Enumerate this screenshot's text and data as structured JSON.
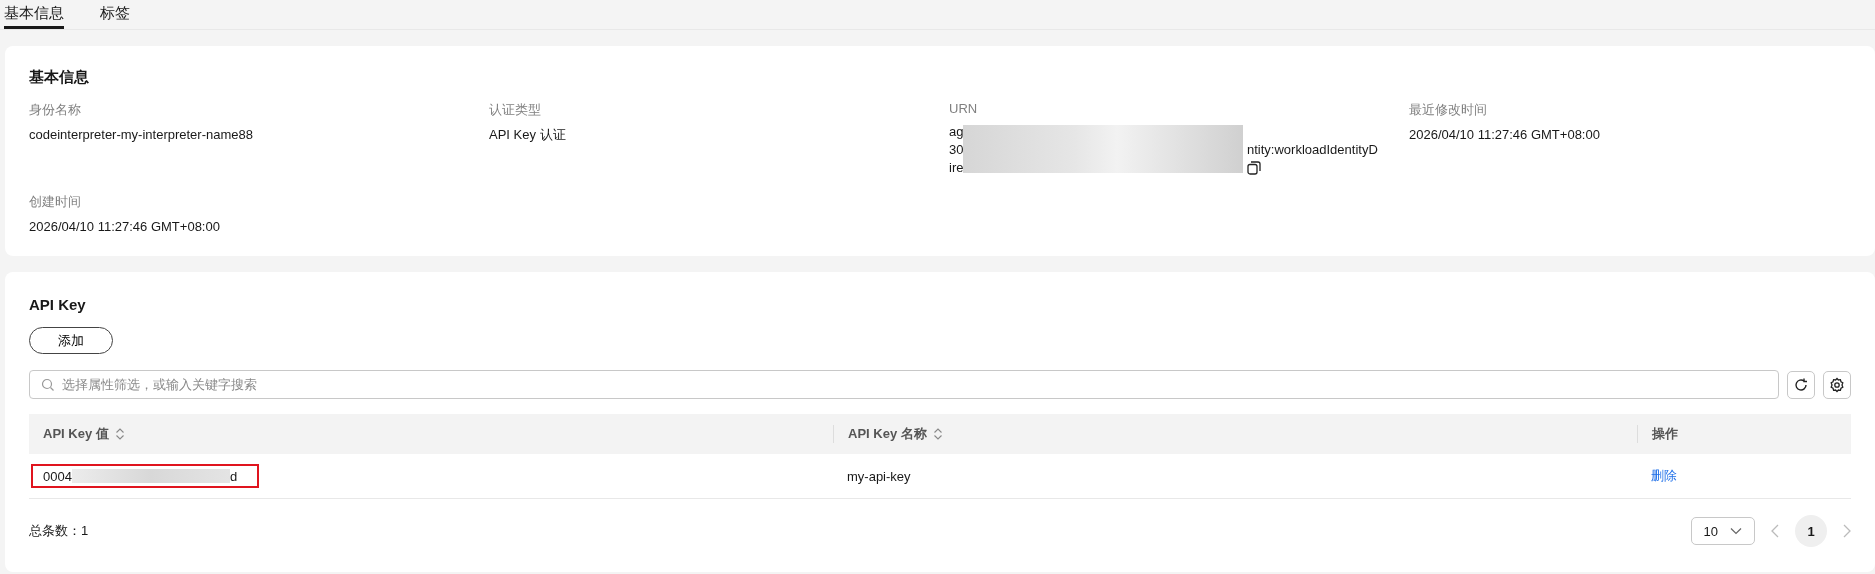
{
  "tabs": [
    {
      "label": "基本信息",
      "selected": true
    },
    {
      "label": "标签",
      "selected": false
    }
  ],
  "basic_info": {
    "title": "基本信息",
    "fields": [
      {
        "label": "身份名称",
        "value": "codeinterpreter-my-interpreter-name88"
      },
      {
        "label": "认证类型",
        "value": "API Key 认证"
      },
      {
        "label": "URN",
        "kind": "redacted",
        "lines": [
          {
            "start": "ag"
          },
          {
            "start": "30",
            "end": "ntity:workloadIdentityD"
          },
          {
            "start": "ire"
          }
        ]
      },
      {
        "label": "最近修改时间",
        "value": "2026/04/10 11:27:46 GMT+08:00"
      },
      {
        "label": "创建时间",
        "value": "2026/04/10 11:27:46 GMT+08:00"
      }
    ]
  },
  "api_keys": {
    "title": "API Key",
    "add_button": "添加",
    "search": {
      "placeholder": "选择属性筛选，或输入关键字搜索"
    },
    "columns": [
      {
        "label": "API Key 值",
        "sortable": true
      },
      {
        "label": "API Key 名称",
        "sortable": true
      },
      {
        "label": "操作",
        "sortable": false
      }
    ],
    "rows": [
      {
        "key_start": "0004",
        "key_end": "d",
        "highlighted": true,
        "name": "my-api-key",
        "action": "删除"
      }
    ],
    "total": "总条数：1",
    "page_size": "10",
    "pages": [
      {
        "label": "1",
        "selected": true
      }
    ]
  }
}
